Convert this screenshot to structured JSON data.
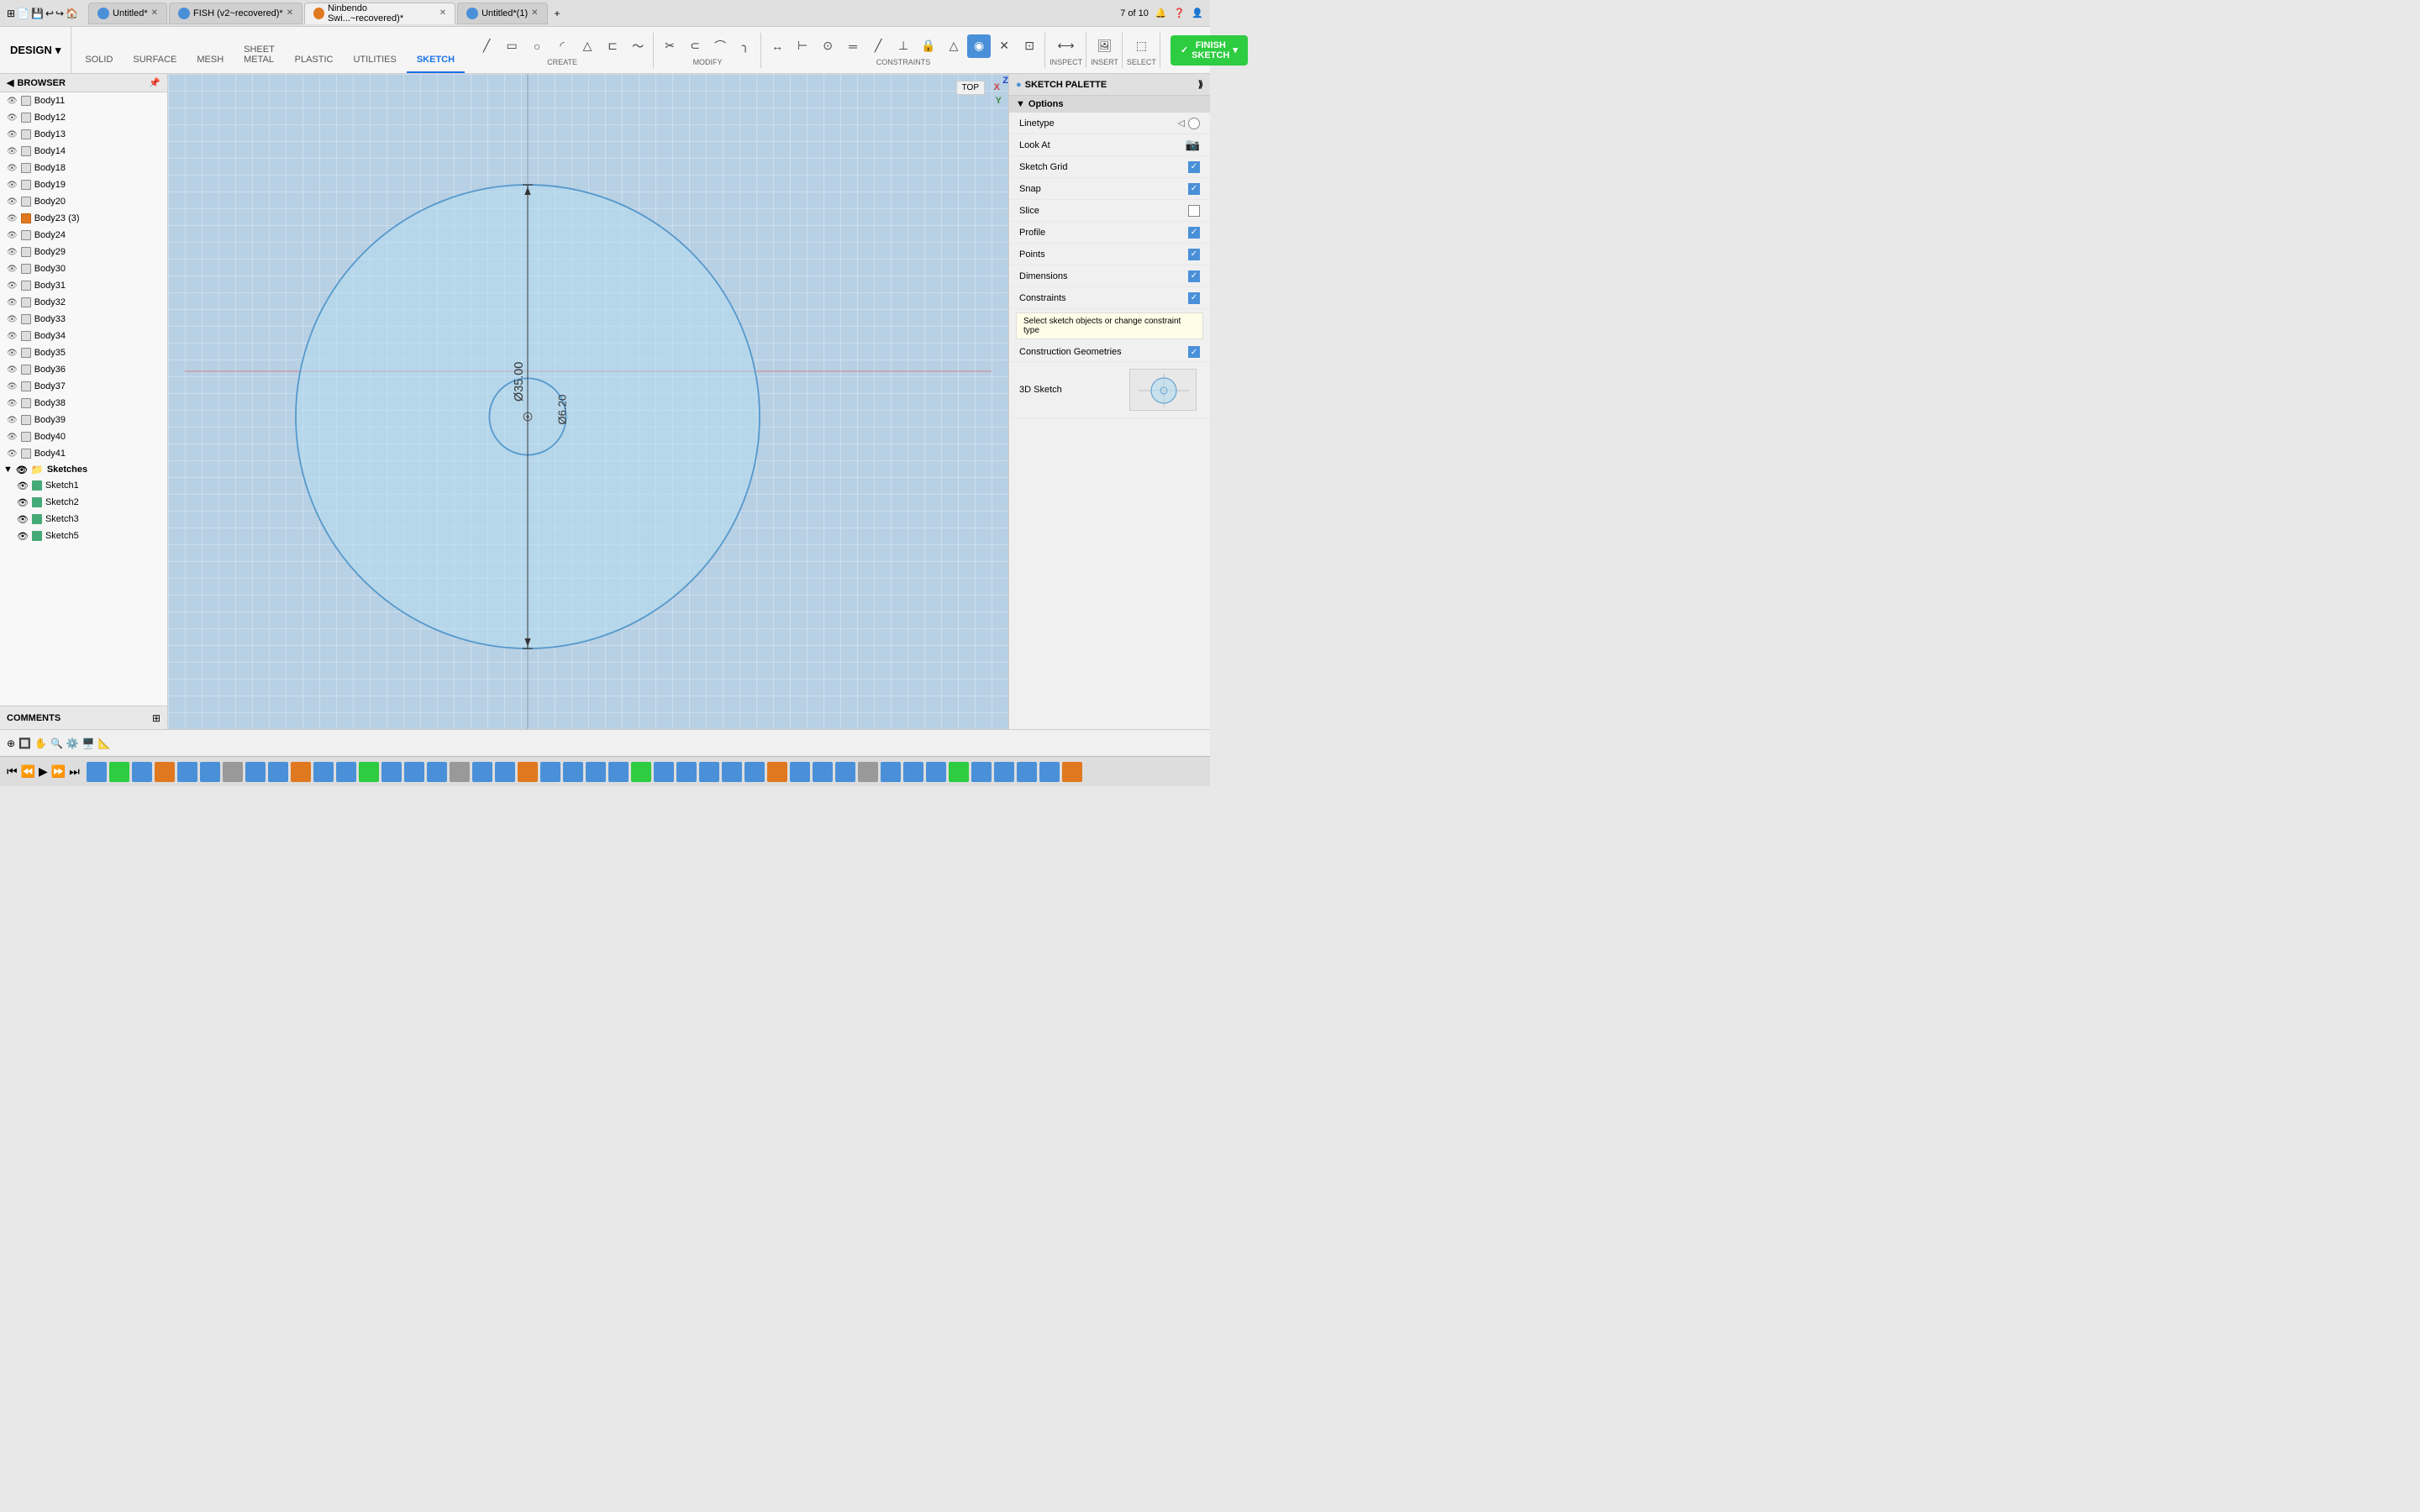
{
  "titlebar": {
    "apps_icon": "⊞",
    "tabs": [
      {
        "label": "Untitled*",
        "icon": "file",
        "active": false,
        "color": "#4a90d9"
      },
      {
        "label": "FISH (v2~recovered)*",
        "icon": "file",
        "active": false,
        "color": "#4a90d9"
      },
      {
        "label": "Ninbendo Swi...~recovered)*",
        "icon": "file",
        "active": true,
        "color": "#e07820"
      },
      {
        "label": "Untitled*(1)",
        "icon": "file",
        "active": false,
        "color": "#4a90d9"
      }
    ],
    "new_tab": "+",
    "tab_count": "7 of 10",
    "user_icon": "👤"
  },
  "toolbar": {
    "design_label": "DESIGN",
    "tabs": [
      "SOLID",
      "SURFACE",
      "MESH",
      "SHEET METAL",
      "PLASTIC",
      "UTILITIES",
      "SKETCH"
    ],
    "active_tab": "SKETCH",
    "create_label": "CREATE",
    "modify_label": "MODIFY",
    "constraints_label": "CONSTRAINTS",
    "inspect_label": "INSPECT",
    "insert_label": "INSERT",
    "select_label": "SELECT",
    "finish_sketch_label": "FINISH SKETCH"
  },
  "browser": {
    "header": "BROWSER",
    "items": [
      {
        "name": "Body11",
        "has_warning": false
      },
      {
        "name": "Body12",
        "has_warning": false
      },
      {
        "name": "Body13",
        "has_warning": false
      },
      {
        "name": "Body14",
        "has_warning": false
      },
      {
        "name": "Body18",
        "has_warning": false
      },
      {
        "name": "Body19",
        "has_warning": false
      },
      {
        "name": "Body20",
        "has_warning": false
      },
      {
        "name": "Body23 (3)",
        "has_warning": true,
        "orange": true
      },
      {
        "name": "Body24",
        "has_warning": false
      },
      {
        "name": "Body29",
        "has_warning": false
      },
      {
        "name": "Body30",
        "has_warning": false
      },
      {
        "name": "Body31",
        "has_warning": false
      },
      {
        "name": "Body32",
        "has_warning": false
      },
      {
        "name": "Body33",
        "has_warning": false
      },
      {
        "name": "Body34",
        "has_warning": false
      },
      {
        "name": "Body35",
        "has_warning": false
      },
      {
        "name": "Body36",
        "has_warning": false
      },
      {
        "name": "Body37",
        "has_warning": false
      },
      {
        "name": "Body38",
        "has_warning": false
      },
      {
        "name": "Body39",
        "has_warning": false
      },
      {
        "name": "Body40",
        "has_warning": false
      },
      {
        "name": "Body41",
        "has_warning": false
      }
    ],
    "sketches_folder": "Sketches",
    "sketches": [
      {
        "name": "Sketch1"
      },
      {
        "name": "Sketch2"
      },
      {
        "name": "Sketch3"
      },
      {
        "name": "Sketch5"
      }
    ]
  },
  "canvas": {
    "large_circle_diameter": "Ø35.00",
    "small_circle_diameter": "Ø6.20",
    "x_label": "X",
    "y_label": "Y",
    "z_label": "Z",
    "view_label": "TOP"
  },
  "sketch_palette": {
    "title": "SKETCH PALETTE",
    "options_label": "Options",
    "rows": [
      {
        "label": "Linetype",
        "type": "linetype"
      },
      {
        "label": "Look At",
        "type": "icon",
        "icon": "📷"
      },
      {
        "label": "Sketch Grid",
        "type": "checkbox",
        "checked": true
      },
      {
        "label": "Snap",
        "type": "checkbox",
        "checked": true
      },
      {
        "label": "Slice",
        "type": "checkbox",
        "checked": false
      },
      {
        "label": "Profile",
        "type": "checkbox",
        "checked": true
      },
      {
        "label": "Points",
        "type": "checkbox",
        "checked": true
      },
      {
        "label": "Dimensions",
        "type": "checkbox",
        "checked": true
      },
      {
        "label": "Constraints",
        "type": "checkbox",
        "checked": true
      }
    ],
    "tooltip": "Select sketch objects or change constraint type",
    "construction_geometries_label": "Construction Geometries",
    "construction_checked": true,
    "3d_sketch_label": "3D Sketch"
  },
  "comments": {
    "label": "COMMENTS"
  },
  "bottom_tools": [
    "⊕",
    "🔲",
    "✋",
    "🔍",
    "⚙️",
    "🖥️",
    "📐"
  ],
  "playback": {
    "controls": [
      "⏮",
      "⏪",
      "▶",
      "⏩",
      "⏭"
    ]
  }
}
